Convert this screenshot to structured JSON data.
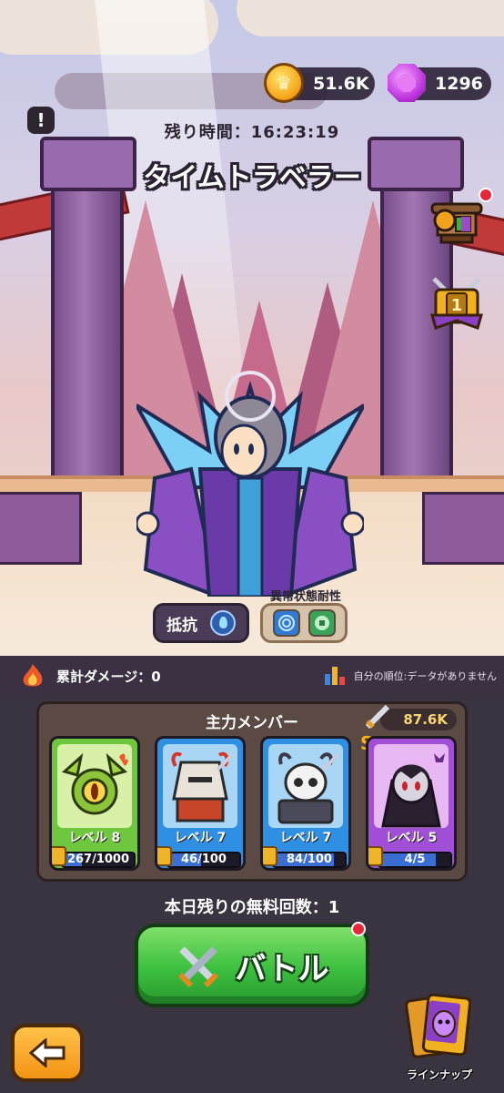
{
  "currency": {
    "coins": "51.6K",
    "gems": "1296"
  },
  "event": {
    "timer_label": "残り時間：",
    "timer_value": "16:23:19",
    "boss_name": "タイムトラベラー"
  },
  "boss_traits": {
    "resist_label": "抵抗",
    "status_resist_label": "異常状態耐性"
  },
  "damage": {
    "label": "累計ダメージ：",
    "value": "0",
    "rank_text": "自分の順位:データがありません"
  },
  "team": {
    "title": "主力メンバー",
    "power": "87.6K",
    "rank": "S",
    "members": [
      {
        "level": "レベル 8",
        "progress": "267/1000",
        "fill": 0.267,
        "color": "#6fc63f"
      },
      {
        "level": "レベル 7",
        "progress": "46/100",
        "fill": 0.46,
        "color": "#2f8fe3"
      },
      {
        "level": "レベル 7",
        "progress": "84/100",
        "fill": 0.84,
        "color": "#2f8fe3"
      },
      {
        "level": "レベル 5",
        "progress": "4/5",
        "fill": 0.8,
        "color": "#a24fd8"
      }
    ]
  },
  "free_attempts": "本日残りの無料回数：1",
  "battle_button": "バトル",
  "lineup_button": "ラインナップ",
  "icons": {
    "coin": "crown-coin-icon",
    "gem": "purple-gem-icon",
    "alert": "exclamation-icon",
    "back": "back-arrow-icon"
  }
}
